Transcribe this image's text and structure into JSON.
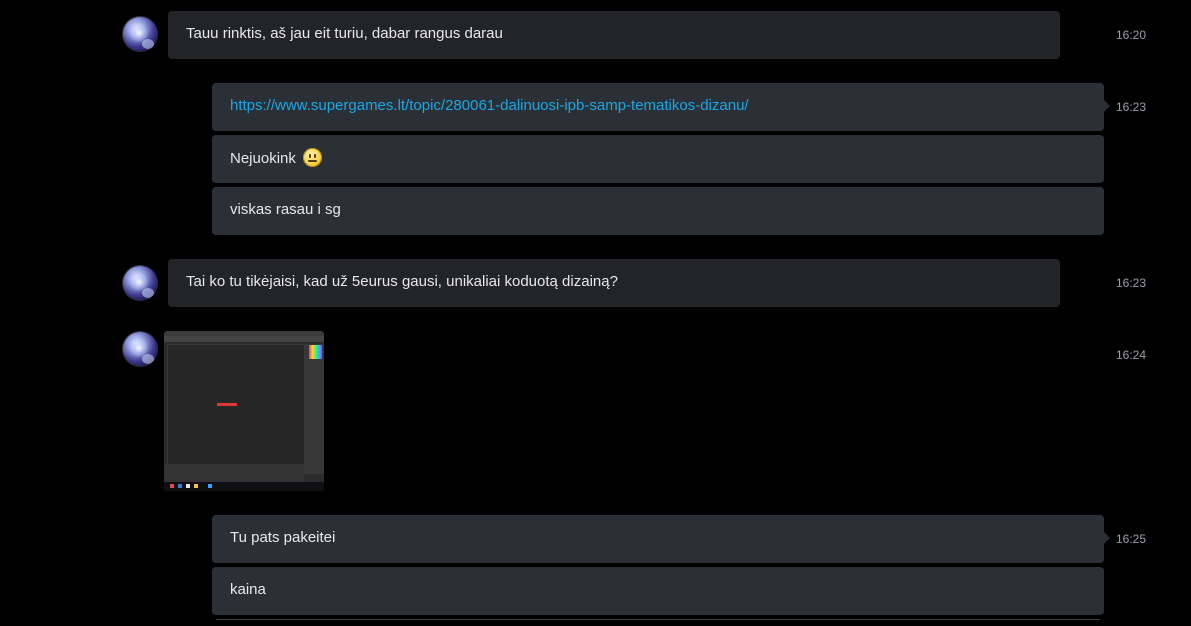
{
  "messages": [
    {
      "text": "Tauu rinktis, aš jau eit turiu, dabar rangus darau",
      "time": "16:20"
    },
    {
      "link": "https://www.supergames.lt/topic/280061-dalinuosi-ipb-samp-tematikos-dizanu/",
      "time": "16:23"
    },
    {
      "text": "Nejuokink"
    },
    {
      "text": "viskas rasau i sg"
    },
    {
      "text": "Tai ko tu tikėjaisi, kad už 5eurus gausi, unikaliai koduotą dizainą?",
      "time": "16:23"
    },
    {
      "image": "screenshot-image",
      "time": "16:24"
    },
    {
      "text": "Tu pats pakeitei",
      "time": "16:25"
    },
    {
      "text": "kaina"
    }
  ],
  "icons": {
    "avatar": "avatar",
    "emoji": "smile-emoji-icon"
  },
  "colors": {
    "background": "#000000",
    "bubble_incoming": "#222428",
    "bubble_outgoing": "#2b3036",
    "link": "#1aa7e6",
    "time": "#9aa0a6"
  }
}
